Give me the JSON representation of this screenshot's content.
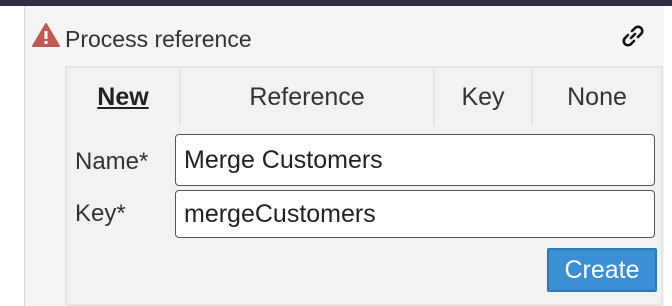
{
  "header": {
    "title": "Process reference",
    "warning_icon": "warning-triangle-icon",
    "link_icon": "link-icon"
  },
  "tabs": [
    {
      "label": "New",
      "active": true
    },
    {
      "label": "Reference",
      "active": false
    },
    {
      "label": "Key",
      "active": false
    },
    {
      "label": "None",
      "active": false
    }
  ],
  "form": {
    "name_label": "Name*",
    "name_value": "Merge Customers",
    "key_label": "Key*",
    "key_value": "mergeCustomers",
    "create_label": "Create"
  },
  "colors": {
    "warning": "#c05a52",
    "button": "#3b8fd4",
    "topbar": "#2b3140"
  }
}
